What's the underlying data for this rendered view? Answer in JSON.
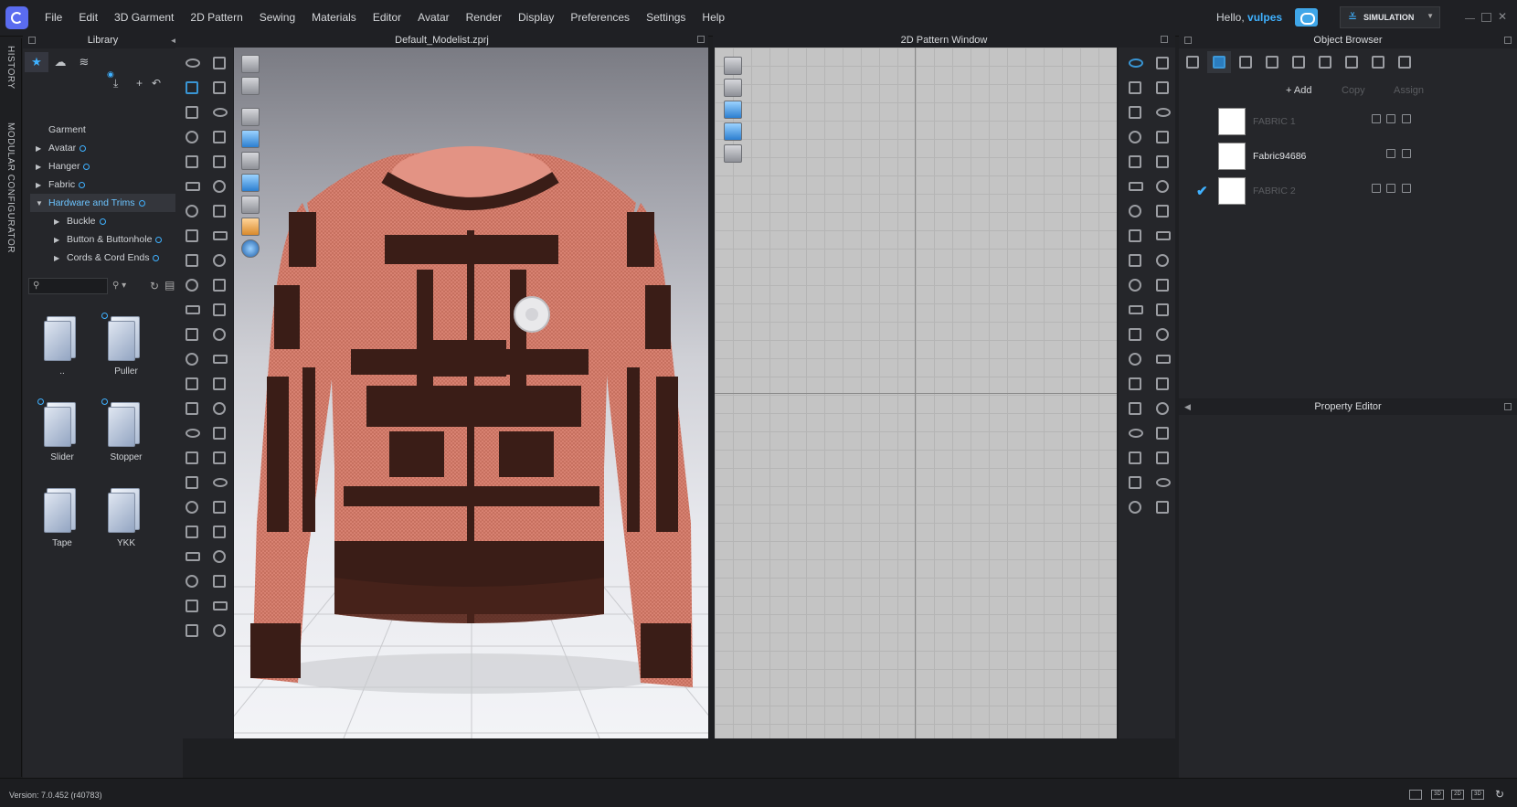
{
  "menu": [
    "File",
    "Edit",
    "3D Garment",
    "2D Pattern",
    "Sewing",
    "Materials",
    "Editor",
    "Avatar",
    "Render",
    "Display",
    "Preferences",
    "Settings",
    "Help"
  ],
  "user": {
    "greeting": "Hello,",
    "name": "vulpes"
  },
  "mode": {
    "label": "SIMULATION"
  },
  "side_tabs": [
    "HISTORY",
    "MODULAR CONFIGURATOR"
  ],
  "library": {
    "title": "Library",
    "tree": [
      {
        "label": "Garment",
        "level": 0,
        "arrow": ""
      },
      {
        "label": "Avatar",
        "level": 0,
        "arrow": "▶"
      },
      {
        "label": "Hanger",
        "level": 0,
        "arrow": "▶"
      },
      {
        "label": "Fabric",
        "level": 0,
        "arrow": "▶"
      },
      {
        "label": "Hardware and Trims",
        "level": 0,
        "arrow": "▼"
      },
      {
        "label": "Buckle",
        "level": 1,
        "arrow": "▶"
      },
      {
        "label": "Button & Buttonhole",
        "level": 1,
        "arrow": "▶"
      },
      {
        "label": "Cords & Cord Ends",
        "level": 1,
        "arrow": "▶"
      }
    ],
    "search_placeholder": "",
    "items": [
      "..",
      "Puller",
      "Slider",
      "Stopper",
      "Tape",
      "YKK"
    ]
  },
  "viewport3d": {
    "title": "Default_Modelist.zprj"
  },
  "viewport2d": {
    "title": "2D Pattern Window"
  },
  "object_browser": {
    "title": "Object Browser",
    "actions": {
      "add": "+ Add",
      "copy": "Copy",
      "assign": "Assign"
    },
    "fabrics": [
      {
        "name": "FABRIC 1",
        "selected": false,
        "dimmed": true
      },
      {
        "name": "Fabric94686",
        "selected": false,
        "dimmed": false
      },
      {
        "name": "FABRIC 2",
        "selected": true,
        "dimmed": true
      }
    ]
  },
  "property_editor": {
    "title": "Property Editor"
  },
  "status": {
    "version": "Version: 7.0.452 (r40783)"
  },
  "colors": {
    "accent": "#3fb1ff",
    "sweater": "#d98373",
    "sweater_dark": "#3a1d17"
  }
}
